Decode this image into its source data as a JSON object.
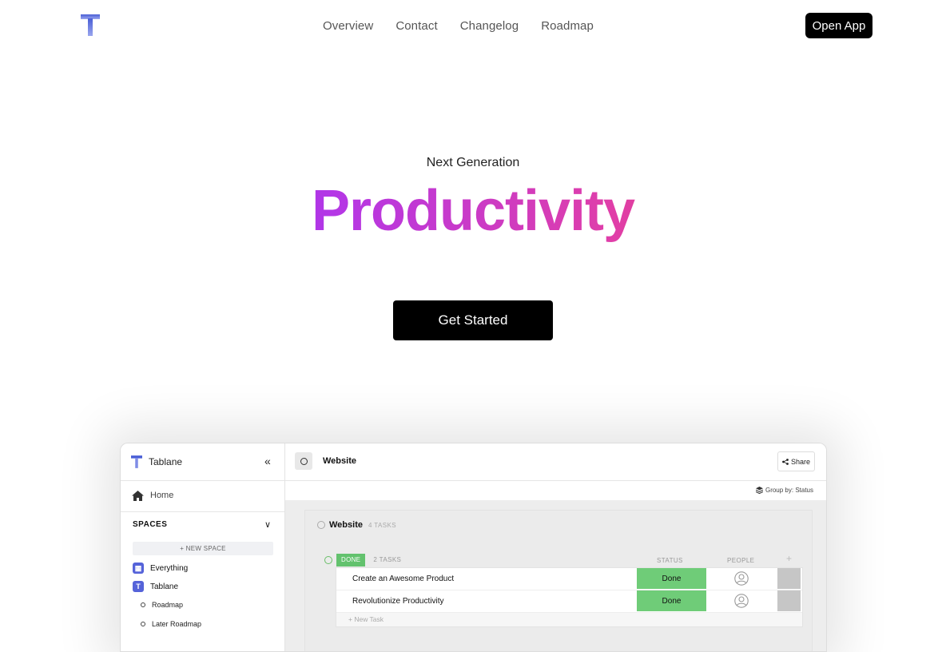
{
  "nav": {
    "links": [
      "Overview",
      "Contact",
      "Changelog",
      "Roadmap"
    ],
    "open_app": "Open App"
  },
  "hero": {
    "subtitle": "Next Generation",
    "title": "Productivity",
    "cta": "Get Started"
  },
  "preview": {
    "sidebar": {
      "app_name": "Tablane",
      "home": "Home",
      "spaces_heading": "SPACES",
      "new_space": "+ NEW SPACE",
      "items": [
        {
          "label": "Everything",
          "icon": "grid-icon"
        },
        {
          "label": "Tablane",
          "icon": "T"
        }
      ],
      "subitems": [
        "Roadmap",
        "Later Roadmap"
      ]
    },
    "main": {
      "title": "Website",
      "share": "Share",
      "group_by": "Group by: Status",
      "list": {
        "title": "Website",
        "count": "4 TASKS",
        "group": {
          "status": "DONE",
          "count": "2 TASKS",
          "col_status": "STATUS",
          "col_people": "PEOPLE",
          "col_add": "+",
          "tasks": [
            {
              "name": "Create an Awesome Product",
              "status": "Done"
            },
            {
              "name": "Revolutionize Productivity",
              "status": "Done"
            }
          ],
          "new_task": "+ New Task"
        }
      }
    }
  },
  "colors": {
    "gradient": [
      "#6b1ef5",
      "#b437e6",
      "#e03ea8",
      "#e2413a"
    ],
    "done_green": "#6fcc78",
    "accent": "#5563d9"
  }
}
